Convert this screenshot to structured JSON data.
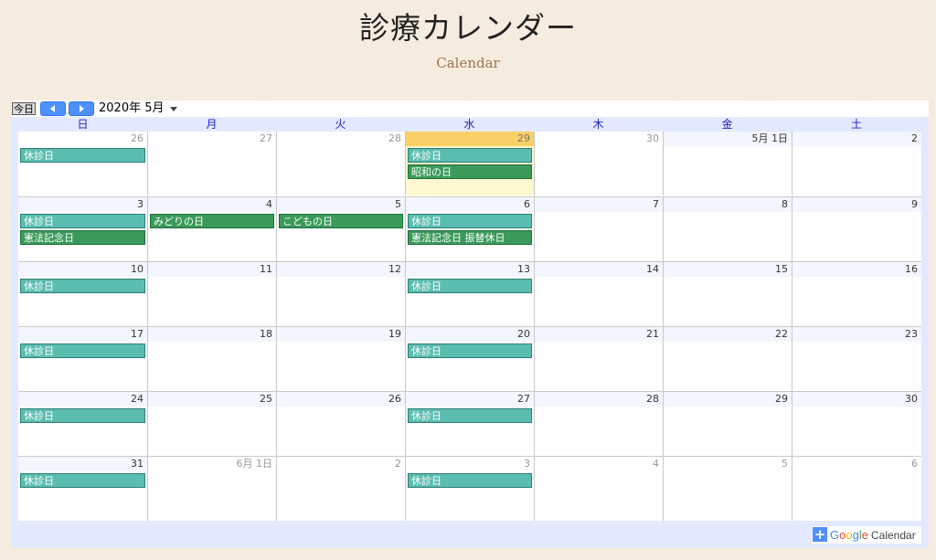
{
  "header": {
    "title": "診療カレンダー",
    "subtitle": "Calendar"
  },
  "nav": {
    "today_label": "今日",
    "prev_icon": "chevron-left-icon",
    "next_icon": "chevron-right-icon",
    "month_label": "2020年 5月"
  },
  "weekdays": [
    "日",
    "月",
    "火",
    "水",
    "木",
    "金",
    "土"
  ],
  "colors": {
    "closed_event": "#5bbdb0",
    "holiday_event": "#3a9a5a",
    "today_header": "#f9d065",
    "weekday_text": "#2020c0"
  },
  "weeks": [
    {
      "days": [
        {
          "label": "26",
          "other": true,
          "events": [
            {
              "title": "休診日",
              "type": "closed"
            }
          ]
        },
        {
          "label": "27",
          "other": true,
          "events": []
        },
        {
          "label": "28",
          "other": true,
          "events": []
        },
        {
          "label": "29",
          "other": true,
          "today": true,
          "events": [
            {
              "title": "休診日",
              "type": "closed"
            },
            {
              "title": "昭和の日",
              "type": "holiday"
            }
          ]
        },
        {
          "label": "30",
          "other": true,
          "events": []
        },
        {
          "label": "5月 1日",
          "events": []
        },
        {
          "label": "2",
          "events": []
        }
      ]
    },
    {
      "days": [
        {
          "label": "3",
          "events": [
            {
              "title": "休診日",
              "type": "closed"
            },
            {
              "title": "憲法記念日",
              "type": "holiday"
            }
          ]
        },
        {
          "label": "4",
          "events": [
            {
              "title": "みどりの日",
              "type": "holiday"
            }
          ]
        },
        {
          "label": "5",
          "events": [
            {
              "title": "こどもの日",
              "type": "holiday"
            }
          ]
        },
        {
          "label": "6",
          "events": [
            {
              "title": "休診日",
              "type": "closed"
            },
            {
              "title": "憲法記念日 振替休日",
              "type": "holiday"
            }
          ]
        },
        {
          "label": "7",
          "events": []
        },
        {
          "label": "8",
          "events": []
        },
        {
          "label": "9",
          "events": []
        }
      ]
    },
    {
      "days": [
        {
          "label": "10",
          "events": [
            {
              "title": "休診日",
              "type": "closed"
            }
          ]
        },
        {
          "label": "11",
          "events": []
        },
        {
          "label": "12",
          "events": []
        },
        {
          "label": "13",
          "events": [
            {
              "title": "休診日",
              "type": "closed"
            }
          ]
        },
        {
          "label": "14",
          "events": []
        },
        {
          "label": "15",
          "events": []
        },
        {
          "label": "16",
          "events": []
        }
      ]
    },
    {
      "days": [
        {
          "label": "17",
          "events": [
            {
              "title": "休診日",
              "type": "closed"
            }
          ]
        },
        {
          "label": "18",
          "events": []
        },
        {
          "label": "19",
          "events": []
        },
        {
          "label": "20",
          "events": [
            {
              "title": "休診日",
              "type": "closed"
            }
          ]
        },
        {
          "label": "21",
          "events": []
        },
        {
          "label": "22",
          "events": []
        },
        {
          "label": "23",
          "events": []
        }
      ]
    },
    {
      "days": [
        {
          "label": "24",
          "events": [
            {
              "title": "休診日",
              "type": "closed"
            }
          ]
        },
        {
          "label": "25",
          "events": []
        },
        {
          "label": "26",
          "events": []
        },
        {
          "label": "27",
          "events": [
            {
              "title": "休診日",
              "type": "closed"
            }
          ]
        },
        {
          "label": "28",
          "events": []
        },
        {
          "label": "29",
          "events": []
        },
        {
          "label": "30",
          "events": []
        }
      ]
    },
    {
      "days": [
        {
          "label": "31",
          "events": [
            {
              "title": "休診日",
              "type": "closed"
            }
          ]
        },
        {
          "label": "6月 1日",
          "other": true,
          "events": []
        },
        {
          "label": "2",
          "other": true,
          "events": []
        },
        {
          "label": "3",
          "other": true,
          "events": [
            {
              "title": "休診日",
              "type": "closed"
            }
          ]
        },
        {
          "label": "4",
          "other": true,
          "events": []
        },
        {
          "label": "5",
          "other": true,
          "events": []
        },
        {
          "label": "6",
          "other": true,
          "events": []
        }
      ]
    }
  ],
  "footer": {
    "badge_icon": "plus-icon",
    "badge_google": "Google",
    "badge_calendar": "Calendar"
  }
}
